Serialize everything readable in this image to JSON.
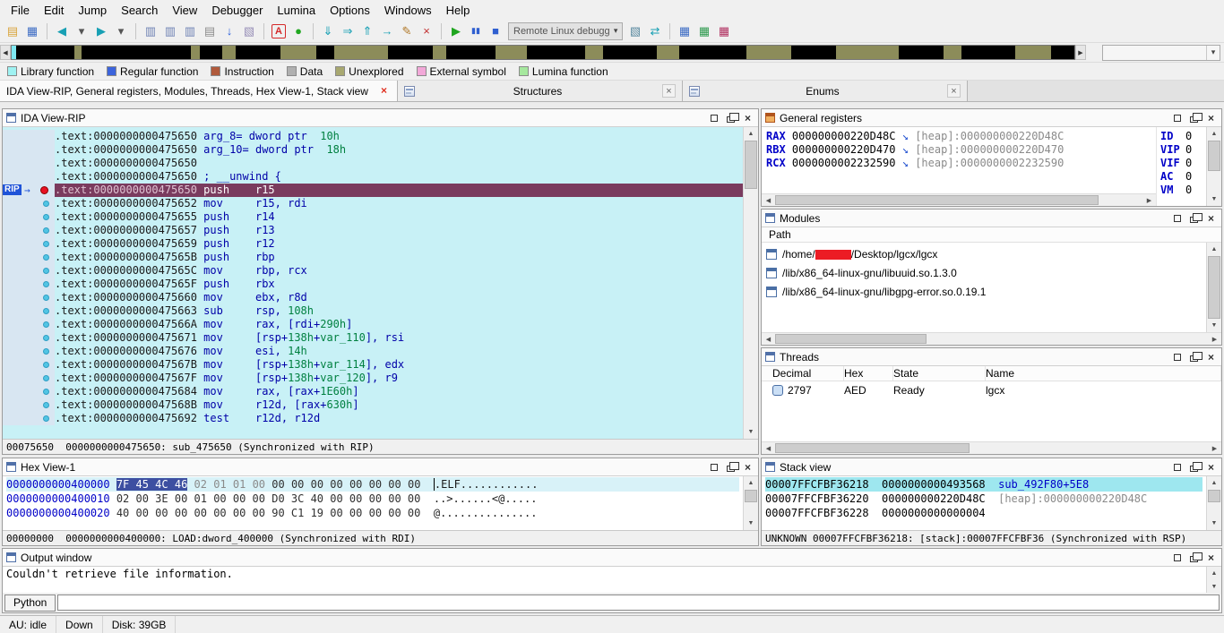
{
  "icons": {
    "close": "×",
    "up": "▲",
    "down": "▼",
    "left": "◀",
    "right": "▶",
    "dropdown": "▾",
    "rip_arrow": "→",
    "pointer_arrow": "↘"
  },
  "menu": {
    "items": [
      "File",
      "Edit",
      "Jump",
      "Search",
      "View",
      "Debugger",
      "Lumina",
      "Options",
      "Windows",
      "Help"
    ]
  },
  "toolbar": {
    "debugger_combo": {
      "value": "Remote Linux debugger"
    },
    "icons_left": [
      {
        "name": "open-file-icon",
        "glyph": "▤",
        "color": "#D9A43B"
      },
      {
        "name": "save-icon",
        "glyph": "▦",
        "color": "#3D6CC4"
      },
      {
        "name": "sep"
      },
      {
        "name": "back-icon",
        "glyph": "◀",
        "color": "#18A0B4"
      },
      {
        "name": "back-dropdown-icon",
        "glyph": "▾",
        "color": "#555555"
      },
      {
        "name": "forward-icon",
        "glyph": "▶",
        "color": "#18A0B4"
      },
      {
        "name": "forward-dropdown-icon",
        "glyph": "▾",
        "color": "#555555"
      },
      {
        "name": "sep"
      },
      {
        "name": "search-binary-icon",
        "glyph": "▥",
        "color": "#6E82B4"
      },
      {
        "name": "search-text-icon",
        "glyph": "▥",
        "color": "#6E82B4"
      },
      {
        "name": "search-sequence-icon",
        "glyph": "▥",
        "color": "#6E82B4"
      },
      {
        "name": "print-icon",
        "glyph": "▤",
        "color": "#8C8C8C"
      },
      {
        "name": "jump-address-icon",
        "glyph": "↓",
        "color": "#2B5FDC"
      },
      {
        "name": "color-instruction-icon",
        "glyph": "▧",
        "color": "#9890B8"
      },
      {
        "name": "sep"
      },
      {
        "name": "ascii-string-icon",
        "glyph": "A",
        "color": "#D42828",
        "box": true
      },
      {
        "name": "run-trace-icon",
        "glyph": "●",
        "color": "#22A822"
      },
      {
        "name": "sep"
      },
      {
        "name": "step-into-icon",
        "glyph": "⇓",
        "color": "#18A0B4"
      },
      {
        "name": "step-over-icon",
        "glyph": "⇒",
        "color": "#18A0B4"
      },
      {
        "name": "run-until-return-icon",
        "glyph": "⇑",
        "color": "#18A0B4"
      },
      {
        "name": "run-to-cursor-icon",
        "glyph": "→",
        "color": "#18A0B4"
      },
      {
        "name": "edit-breakpoint-icon",
        "glyph": "✎",
        "color": "#B07828"
      },
      {
        "name": "remove-breakpoint-icon",
        "glyph": "×",
        "color": "#C23030"
      },
      {
        "name": "sep"
      },
      {
        "name": "continue-process-icon",
        "glyph": "▶",
        "color": "#1FA51F"
      },
      {
        "name": "pause-process-icon",
        "glyph": "▮▮",
        "color": "#2F5FD0",
        "small": true
      },
      {
        "name": "stop-process-icon",
        "glyph": "■",
        "color": "#2F5FD0"
      }
    ],
    "icons_right": [
      {
        "name": "debugger-setup-icon",
        "glyph": "▧",
        "color": "#5A8AA0"
      },
      {
        "name": "refresh-memory-icon",
        "glyph": "⇄",
        "color": "#18A0B4"
      },
      {
        "name": "sep"
      },
      {
        "name": "debugger-windows-icon",
        "glyph": "▦",
        "color": "#3D6CC4"
      },
      {
        "name": "watch-window-icon",
        "glyph": "▦",
        "color": "#2F9A4F"
      },
      {
        "name": "breakpoint-list-icon",
        "glyph": "▦",
        "color": "#B03060"
      }
    ]
  },
  "nav_band": {
    "segments": [
      [
        0,
        5,
        "#7FE9F2"
      ],
      [
        5,
        65,
        "#000000"
      ],
      [
        70,
        8,
        "#8C8C5A"
      ],
      [
        78,
        122,
        "#000000"
      ],
      [
        200,
        10,
        "#8C8C5A"
      ],
      [
        210,
        25,
        "#000000"
      ],
      [
        235,
        15,
        "#8C8C5A"
      ],
      [
        250,
        50,
        "#000000"
      ],
      [
        300,
        40,
        "#8C8C5A"
      ],
      [
        340,
        20,
        "#000000"
      ],
      [
        360,
        60,
        "#8C8C5A"
      ],
      [
        420,
        50,
        "#000000"
      ],
      [
        470,
        15,
        "#8C8C5A"
      ],
      [
        485,
        55,
        "#000000"
      ],
      [
        540,
        35,
        "#8C8C5A"
      ],
      [
        575,
        65,
        "#000000"
      ],
      [
        640,
        20,
        "#8C8C5A"
      ],
      [
        660,
        60,
        "#000000"
      ],
      [
        720,
        25,
        "#8C8C5A"
      ],
      [
        745,
        75,
        "#000000"
      ],
      [
        820,
        50,
        "#8C8C5A"
      ],
      [
        870,
        50,
        "#000000"
      ],
      [
        920,
        70,
        "#8C8C5A"
      ],
      [
        990,
        50,
        "#000000"
      ],
      [
        1040,
        20,
        "#8C8C5A"
      ],
      [
        1060,
        60,
        "#000000"
      ],
      [
        1120,
        40,
        "#8C8C5A"
      ],
      [
        1160,
        28,
        "#000000"
      ]
    ]
  },
  "legend": {
    "items": [
      {
        "label": "Library function",
        "color": "#9FF2F2"
      },
      {
        "label": "Regular function",
        "color": "#3C64DC"
      },
      {
        "label": "Instruction",
        "color": "#B05A3C"
      },
      {
        "label": "Data",
        "color": "#B0B0B0"
      },
      {
        "label": "Unexplored",
        "color": "#A8A870"
      },
      {
        "label": "External symbol",
        "color": "#F2A8D8"
      },
      {
        "label": "Lumina function",
        "color": "#A6E89E"
      }
    ]
  },
  "desktop_tabs": {
    "main": {
      "label": "IDA View-RIP, General registers, Modules, Threads, Hex View-1, Stack view"
    },
    "structures": {
      "label": "Structures"
    },
    "enums": {
      "label": "Enums"
    }
  },
  "ida_view": {
    "title": "IDA View-RIP",
    "rip_badge": "RIP",
    "status": "00075650  0000000000475650: sub_475650 (Synchronized with RIP)",
    "lines": [
      {
        "addr": ".text:0000000000475650",
        "dot": false,
        "code": [
          [
            "arg_8= dword ptr  ",
            "b"
          ],
          [
            "10h",
            "g"
          ]
        ]
      },
      {
        "addr": ".text:0000000000475650",
        "dot": false,
        "code": [
          [
            "arg_10= dword ptr  ",
            "b"
          ],
          [
            "18h",
            "g"
          ]
        ]
      },
      {
        "addr": ".text:0000000000475650",
        "dot": false,
        "code": []
      },
      {
        "addr": ".text:0000000000475650",
        "dot": false,
        "code": [
          [
            "; __unwind {",
            "b"
          ]
        ]
      },
      {
        "addr": ".text:0000000000475650",
        "rip": true,
        "code": [
          [
            "push    r15",
            "w"
          ]
        ]
      },
      {
        "addr": ".text:0000000000475652",
        "dot": true,
        "code": [
          [
            "mov     r15, rdi",
            "b"
          ]
        ]
      },
      {
        "addr": ".text:0000000000475655",
        "dot": true,
        "code": [
          [
            "push    r14",
            "b"
          ]
        ]
      },
      {
        "addr": ".text:0000000000475657",
        "dot": true,
        "code": [
          [
            "push    r13",
            "b"
          ]
        ]
      },
      {
        "addr": ".text:0000000000475659",
        "dot": true,
        "code": [
          [
            "push    r12",
            "b"
          ]
        ]
      },
      {
        "addr": ".text:000000000047565B",
        "dot": true,
        "code": [
          [
            "push    rbp",
            "b"
          ]
        ]
      },
      {
        "addr": ".text:000000000047565C",
        "dot": true,
        "code": [
          [
            "mov     rbp, rcx",
            "b"
          ]
        ]
      },
      {
        "addr": ".text:000000000047565F",
        "dot": true,
        "code": [
          [
            "push    rbx",
            "b"
          ]
        ]
      },
      {
        "addr": ".text:0000000000475660",
        "dot": true,
        "code": [
          [
            "mov     ebx, r8d",
            "b"
          ]
        ]
      },
      {
        "addr": ".text:0000000000475663",
        "dot": true,
        "code": [
          [
            "sub     rsp, ",
            "b"
          ],
          [
            "108h",
            "g"
          ]
        ]
      },
      {
        "addr": ".text:000000000047566A",
        "dot": true,
        "code": [
          [
            "mov     rax, [rdi+",
            "b"
          ],
          [
            "290h",
            "g"
          ],
          [
            "]",
            "b"
          ]
        ]
      },
      {
        "addr": ".text:0000000000475671",
        "dot": true,
        "code": [
          [
            "mov     [rsp+",
            "b"
          ],
          [
            "138h",
            "g"
          ],
          [
            "+",
            "b"
          ],
          [
            "var_110",
            "g"
          ],
          [
            "], rsi",
            "b"
          ]
        ]
      },
      {
        "addr": ".text:0000000000475676",
        "dot": true,
        "code": [
          [
            "mov     esi, ",
            "b"
          ],
          [
            "14h",
            "g"
          ]
        ]
      },
      {
        "addr": ".text:000000000047567B",
        "dot": true,
        "code": [
          [
            "mov     [rsp+",
            "b"
          ],
          [
            "138h",
            "g"
          ],
          [
            "+",
            "b"
          ],
          [
            "var_114",
            "g"
          ],
          [
            "], edx",
            "b"
          ]
        ]
      },
      {
        "addr": ".text:000000000047567F",
        "dot": true,
        "code": [
          [
            "mov     [rsp+",
            "b"
          ],
          [
            "138h",
            "g"
          ],
          [
            "+",
            "b"
          ],
          [
            "var_120",
            "g"
          ],
          [
            "], r9",
            "b"
          ]
        ]
      },
      {
        "addr": ".text:0000000000475684",
        "dot": true,
        "code": [
          [
            "mov     rax, [rax+",
            "b"
          ],
          [
            "1E60h",
            "g"
          ],
          [
            "]",
            "b"
          ]
        ]
      },
      {
        "addr": ".text:000000000047568B",
        "dot": true,
        "code": [
          [
            "mov     r12d, [rax+",
            "b"
          ],
          [
            "630h",
            "g"
          ],
          [
            "]",
            "b"
          ]
        ]
      },
      {
        "addr": ".text:0000000000475692",
        "dot": true,
        "code": [
          [
            "test    r12d, r12d",
            "b"
          ]
        ]
      }
    ]
  },
  "registers": {
    "title": "General registers",
    "rows": [
      {
        "name": "RAX",
        "value": "000000000220D48C",
        "ann": "[heap]:000000000220D48C"
      },
      {
        "name": "RBX",
        "value": "000000000220D470",
        "ann": "[heap]:000000000220D470"
      },
      {
        "name": "RCX",
        "value": "0000000002232590",
        "ann": "[heap]:0000000002232590"
      }
    ],
    "flags": [
      [
        "ID",
        "0"
      ],
      [
        "VIP",
        "0"
      ],
      [
        "VIF",
        "0"
      ],
      [
        "AC",
        "0"
      ],
      [
        "VM",
        "0"
      ]
    ]
  },
  "modules": {
    "title": "Modules",
    "header": "Path",
    "rows": [
      {
        "prefix": "/home/",
        "redacted": true,
        "suffix": "/Desktop/lgcx/lgcx"
      },
      {
        "prefix": "/lib/x86_64-linux-gnu/libuuid.so.1.3.0"
      },
      {
        "prefix": "/lib/x86_64-linux-gnu/libgpg-error.so.0.19.1"
      }
    ]
  },
  "threads": {
    "title": "Threads",
    "columns": [
      "Decimal",
      "Hex",
      "State",
      "Name"
    ],
    "rows": [
      [
        "2797",
        "AED",
        "Ready",
        "lgcx"
      ]
    ]
  },
  "hex_view": {
    "title": "Hex View-1",
    "status": "00000000  0000000000400000: LOAD:dword_400000 (Synchronized with RDI)",
    "rows": [
      {
        "addr": "0000000000400000",
        "hl": true,
        "cursor": true,
        "ascii": ".ELF............",
        "bytes": [
          [
            "7F",
            "sel"
          ],
          [
            "45",
            "sel"
          ],
          [
            "4C",
            "sel"
          ],
          [
            "46",
            "sel"
          ],
          [
            "02",
            "dim"
          ],
          [
            "01",
            "dim"
          ],
          [
            "01",
            "dim"
          ],
          [
            "00",
            "dim"
          ],
          [
            "00",
            ""
          ],
          [
            "00",
            ""
          ],
          [
            "00",
            ""
          ],
          [
            "00",
            ""
          ],
          [
            "00",
            ""
          ],
          [
            "00",
            ""
          ],
          [
            "00",
            ""
          ],
          [
            "00",
            ""
          ]
        ]
      },
      {
        "addr": "0000000000400010",
        "ascii": "..>......<@.....",
        "bytes": [
          [
            "02",
            ""
          ],
          [
            "00",
            ""
          ],
          [
            "3E",
            ""
          ],
          [
            "00",
            ""
          ],
          [
            "01",
            ""
          ],
          [
            "00",
            ""
          ],
          [
            "00",
            ""
          ],
          [
            "00",
            ""
          ],
          [
            "D0",
            ""
          ],
          [
            "3C",
            ""
          ],
          [
            "40",
            ""
          ],
          [
            "00",
            ""
          ],
          [
            "00",
            ""
          ],
          [
            "00",
            ""
          ],
          [
            "00",
            ""
          ],
          [
            "00",
            ""
          ]
        ]
      },
      {
        "addr": "0000000000400020",
        "ascii": "@...............",
        "bytes": [
          [
            "40",
            ""
          ],
          [
            "00",
            ""
          ],
          [
            "00",
            ""
          ],
          [
            "00",
            ""
          ],
          [
            "00",
            ""
          ],
          [
            "00",
            ""
          ],
          [
            "00",
            ""
          ],
          [
            "00",
            ""
          ],
          [
            "90",
            ""
          ],
          [
            "C1",
            ""
          ],
          [
            "19",
            ""
          ],
          [
            "00",
            ""
          ],
          [
            "00",
            ""
          ],
          [
            "00",
            ""
          ],
          [
            "00",
            ""
          ],
          [
            "00",
            ""
          ]
        ]
      }
    ]
  },
  "stack_view": {
    "title": "Stack view",
    "status": "UNKNOWN 00007FFCFBF36218: [stack]:00007FFCFBF36 (Synchronized with RSP)",
    "rows": [
      {
        "addr": "00007FFCFBF36218",
        "value": "0000000000493568",
        "ann": "sub_492F80+5E8",
        "ann_cls": "fn",
        "hl": true
      },
      {
        "addr": "00007FFCFBF36220",
        "value": "000000000220D48C",
        "ann": "[heap]:000000000220D48C",
        "ann_cls": "seg"
      },
      {
        "addr": "00007FFCFBF36228",
        "value": "0000000000000004",
        "ann": "",
        "ann_cls": ""
      }
    ]
  },
  "output": {
    "title": "Output window",
    "message": "Couldn't retrieve file information.",
    "python_button": "Python",
    "input_value": ""
  },
  "status_bar": {
    "au": "AU: idle",
    "state": "Down",
    "disk": "Disk: 39GB"
  }
}
